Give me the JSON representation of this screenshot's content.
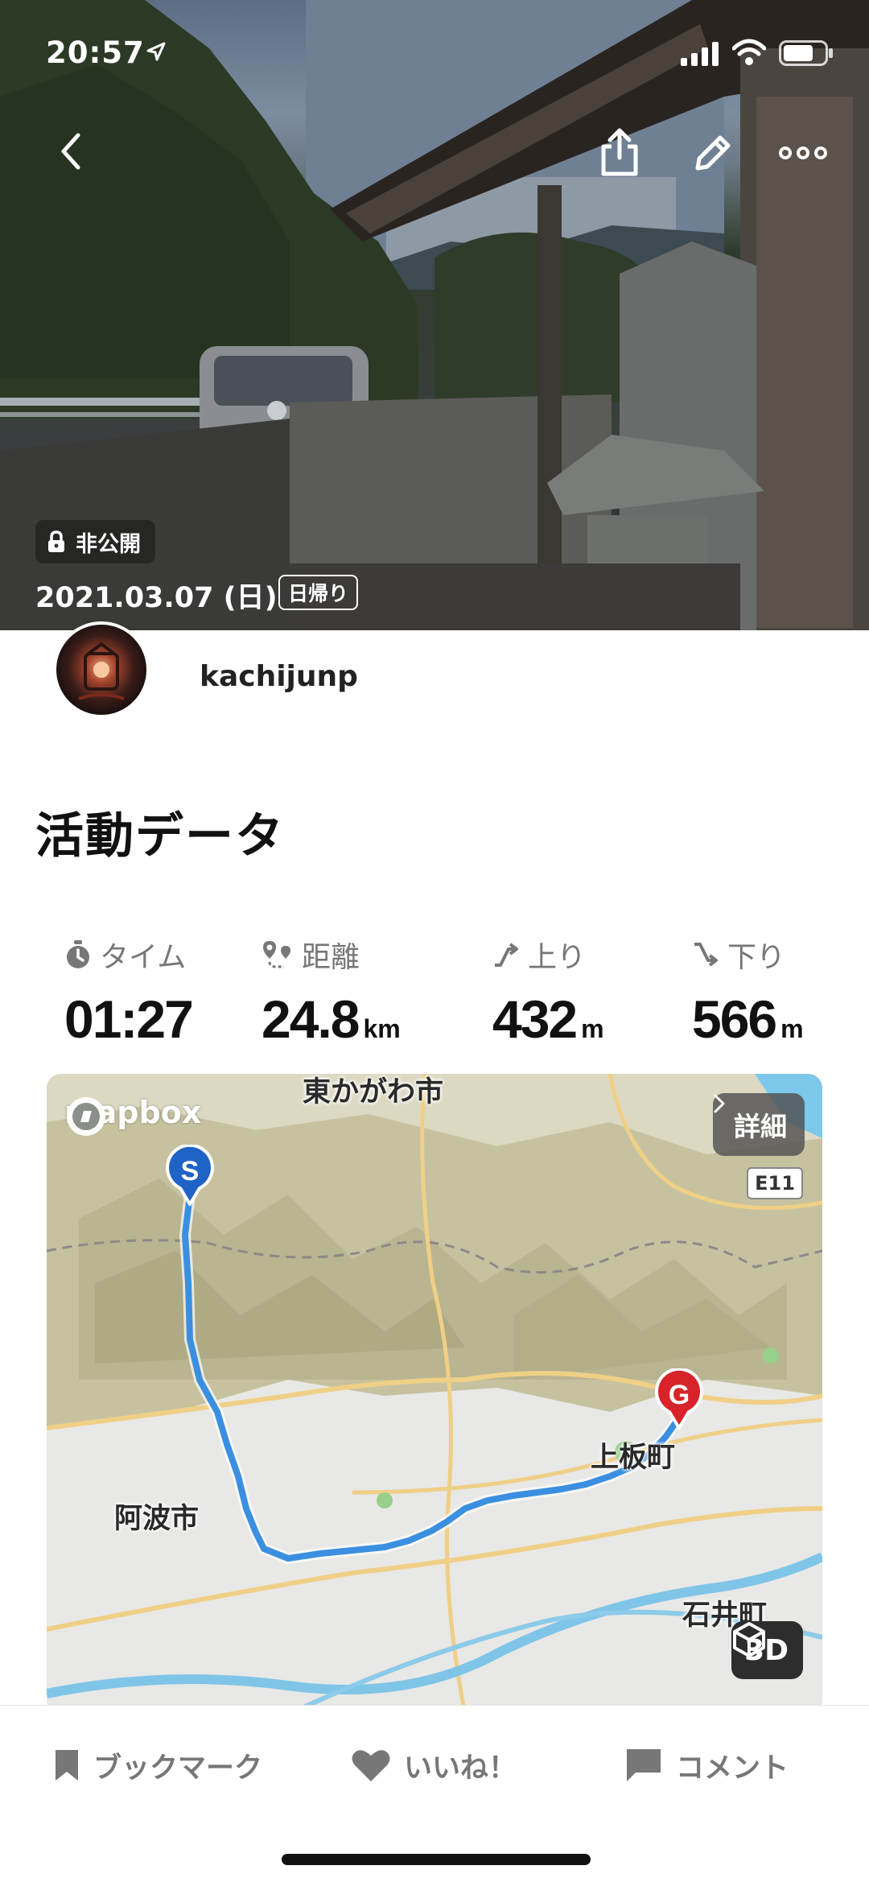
{
  "status_bar": {
    "time": "20:57"
  },
  "header": {
    "privacy_label": "非公開",
    "date": "2021.03.07 (日)",
    "trip_type": "日帰り"
  },
  "user": {
    "name": "kachijunp"
  },
  "section": {
    "title": "活動データ"
  },
  "stats": {
    "time": {
      "label": "タイム",
      "value": "01:27",
      "unit": ""
    },
    "distance": {
      "label": "距離",
      "value": "24.8",
      "unit": "km"
    },
    "ascent": {
      "label": "上り",
      "value": "432",
      "unit": "m"
    },
    "descent": {
      "label": "下り",
      "value": "566",
      "unit": "m"
    }
  },
  "map": {
    "provider_logo": "mapbox",
    "detail_button": "詳細",
    "road_badge": "E11",
    "view_3d_button": "3D",
    "start_pin": "S",
    "goal_pin": "G",
    "labels": {
      "city_top": "東かがわ市",
      "awa": "阿波市",
      "kamiita": "上板町",
      "ishii": "石井町"
    },
    "route_color": "#3b8fe0",
    "start_color": "#1f63c6",
    "goal_color": "#d8232a"
  },
  "actions": {
    "bookmark": "ブックマーク",
    "like": "いいね！",
    "comment": "コメント"
  }
}
